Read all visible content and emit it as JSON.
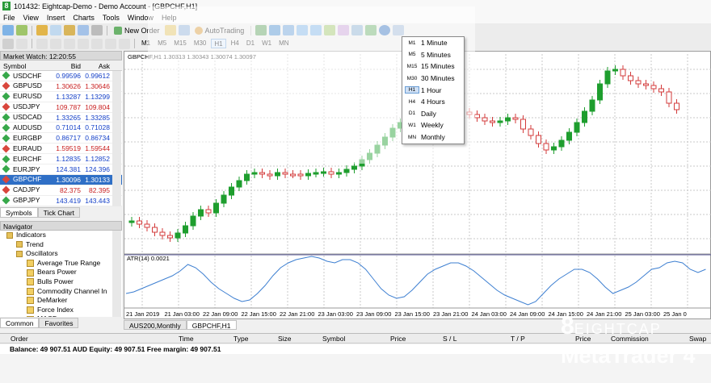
{
  "app": {
    "title": "101432: Eightcap-Demo - Demo Account - [GBPCHF,H1]",
    "logo_char": "8"
  },
  "menu": [
    "File",
    "View",
    "Insert",
    "Charts",
    "Tools",
    "Window",
    "Help"
  ],
  "toolbar": {
    "new_order": "New Order",
    "autotrading": "AutoTrading"
  },
  "timeframes": [
    "M1",
    "M5",
    "M15",
    "M30",
    "H1",
    "H4",
    "D1",
    "W1",
    "MN"
  ],
  "market_watch": {
    "title": "Market Watch: 12:20:55",
    "headers": [
      "Symbol",
      "Bid",
      "Ask"
    ],
    "rows": [
      {
        "symbol": "USDCHF",
        "bid": "0.99596",
        "ask": "0.99612",
        "dir": "g"
      },
      {
        "symbol": "GBPUSD",
        "bid": "1.30626",
        "ask": "1.30646",
        "dir": "r"
      },
      {
        "symbol": "EURUSD",
        "bid": "1.13287",
        "ask": "1.13299",
        "dir": "g"
      },
      {
        "symbol": "USDJPY",
        "bid": "109.787",
        "ask": "109.804",
        "dir": "r"
      },
      {
        "symbol": "USDCAD",
        "bid": "1.33265",
        "ask": "1.33285",
        "dir": "g"
      },
      {
        "symbol": "AUDUSD",
        "bid": "0.71014",
        "ask": "0.71028",
        "dir": "g"
      },
      {
        "symbol": "EURGBP",
        "bid": "0.86717",
        "ask": "0.86734",
        "dir": "g"
      },
      {
        "symbol": "EURAUD",
        "bid": "1.59519",
        "ask": "1.59544",
        "dir": "r"
      },
      {
        "symbol": "EURCHF",
        "bid": "1.12835",
        "ask": "1.12852",
        "dir": "g"
      },
      {
        "symbol": "EURJPY",
        "bid": "124.381",
        "ask": "124.396",
        "dir": "g"
      },
      {
        "symbol": "GBPCHF",
        "bid": "1.30096",
        "ask": "1.30133",
        "dir": "r",
        "selected": true
      },
      {
        "symbol": "CADJPY",
        "bid": "82.375",
        "ask": "82.395",
        "dir": "r"
      },
      {
        "symbol": "GBPJPY",
        "bid": "143.419",
        "ask": "143.443",
        "dir": "g"
      }
    ],
    "tabs": [
      "Symbols",
      "Tick Chart"
    ]
  },
  "navigator": {
    "title": "Navigator",
    "items": [
      {
        "label": "Indicators",
        "level": 1,
        "type": "folder"
      },
      {
        "label": "Trend",
        "level": 2,
        "type": "folder"
      },
      {
        "label": "Oscillators",
        "level": 2,
        "type": "folder"
      },
      {
        "label": "Average True Range",
        "level": 3,
        "type": "ind"
      },
      {
        "label": "Bears Power",
        "level": 3,
        "type": "ind"
      },
      {
        "label": "Bulls Power",
        "level": 3,
        "type": "ind"
      },
      {
        "label": "Commodity Channel In",
        "level": 3,
        "type": "ind"
      },
      {
        "label": "DeMarker",
        "level": 3,
        "type": "ind"
      },
      {
        "label": "Force Index",
        "level": 3,
        "type": "ind"
      },
      {
        "label": "MACD",
        "level": 3,
        "type": "ind"
      }
    ],
    "tabs": [
      "Common",
      "Favorites"
    ]
  },
  "chart": {
    "label": "GBPCHF,H1  1.30313 1.30343 1.30074 1.30097",
    "atr_label": "ATR(14) 0.0021",
    "time_labels": [
      "21 Jan 2019",
      "21 Jan 03:00",
      "22 Jan 09:00",
      "22 Jan 15:00",
      "22 Jan 21:00",
      "23 Jan 03:00",
      "23 Jan 09:00",
      "23 Jan 15:00",
      "23 Jan 21:00",
      "24 Jan 03:00",
      "24 Jan 09:00",
      "24 Jan 15:00",
      "24 Jan 21:00",
      "25 Jan 03:00",
      "25 Jan 0"
    ],
    "tabs": [
      "AUS200,Monthly",
      "GBPCHF,H1"
    ],
    "active_tab": 1
  },
  "timeframe_menu": {
    "items": [
      {
        "code": "M1",
        "label": "1 Minute"
      },
      {
        "code": "M5",
        "label": "5 Minutes"
      },
      {
        "code": "M15",
        "label": "15 Minutes"
      },
      {
        "code": "M30",
        "label": "30 Minutes"
      },
      {
        "code": "H1",
        "label": "1 Hour",
        "highlight": true
      },
      {
        "code": "H4",
        "label": "4 Hours"
      },
      {
        "code": "D1",
        "label": "Daily"
      },
      {
        "code": "W1",
        "label": "Weekly"
      },
      {
        "code": "MN",
        "label": "Monthly"
      }
    ]
  },
  "orders": {
    "headers": [
      "Order",
      "Time",
      "Type",
      "Size",
      "Symbol",
      "Price",
      "S / L",
      "T / P",
      "Price",
      "Commission",
      "Swap"
    ],
    "balance": "Balance: 49 907.51 AUD  Equity: 49 907.51  Free margin: 49 907.51"
  },
  "brand": {
    "line1_big": "8",
    "line1_rest": "EIGHTCAP",
    "line2": "MetaTrader 4"
  },
  "colors": {
    "bull": "#1e9e2e",
    "bear": "#d33b3b",
    "atr": "#3d7fd1",
    "selected": "#2f6fc6"
  }
}
